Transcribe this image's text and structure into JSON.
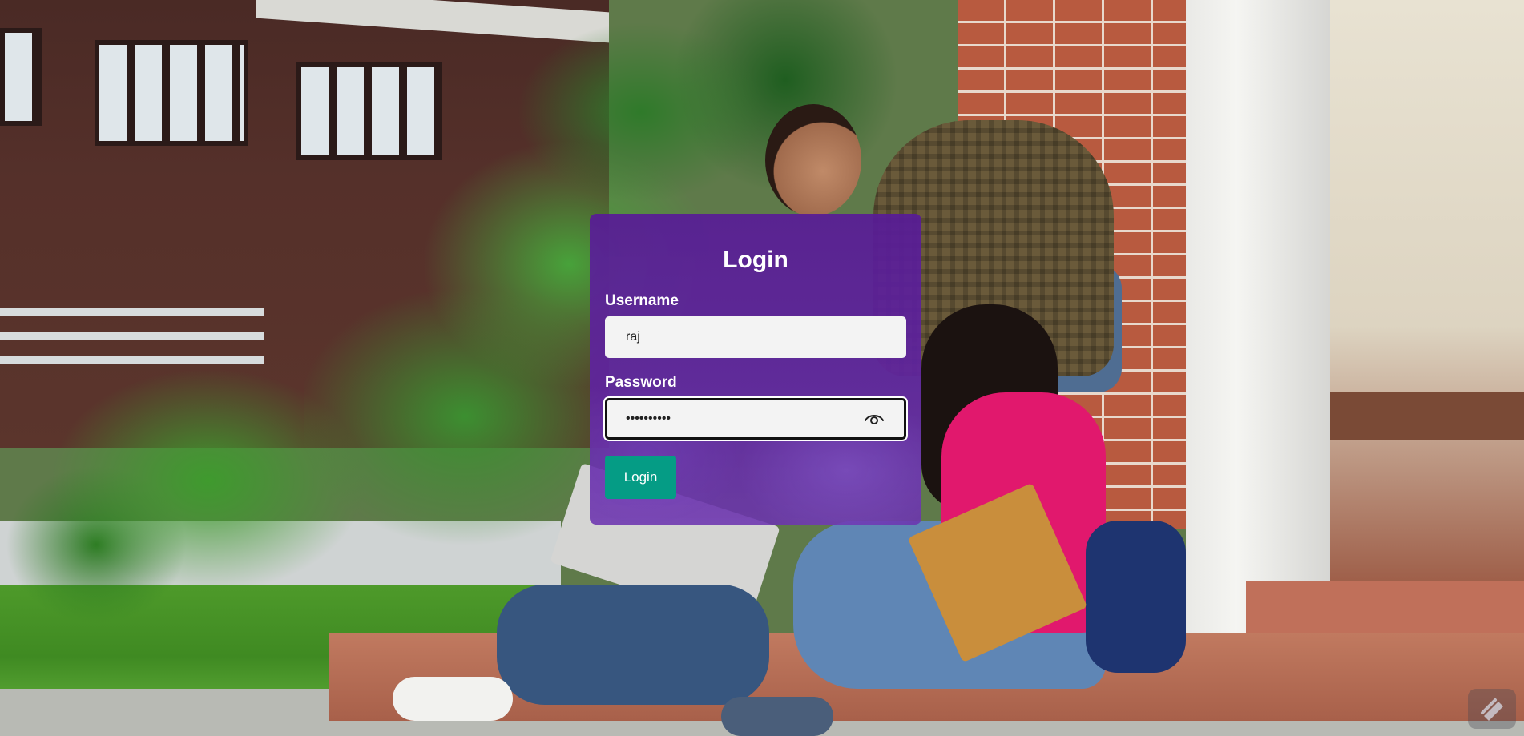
{
  "login": {
    "title": "Login",
    "username_label": "Username",
    "username_value": "raj",
    "password_label": "Password",
    "password_masked": "••••••••••",
    "submit_label": "Login"
  },
  "icons": {
    "password_toggle": "eye-icon",
    "corner_widget": "pen-icon"
  },
  "colors": {
    "card_purple": "#5a1e96",
    "button_teal": "#059c85",
    "input_background": "#f3f3f3",
    "text_white": "#ffffff"
  }
}
